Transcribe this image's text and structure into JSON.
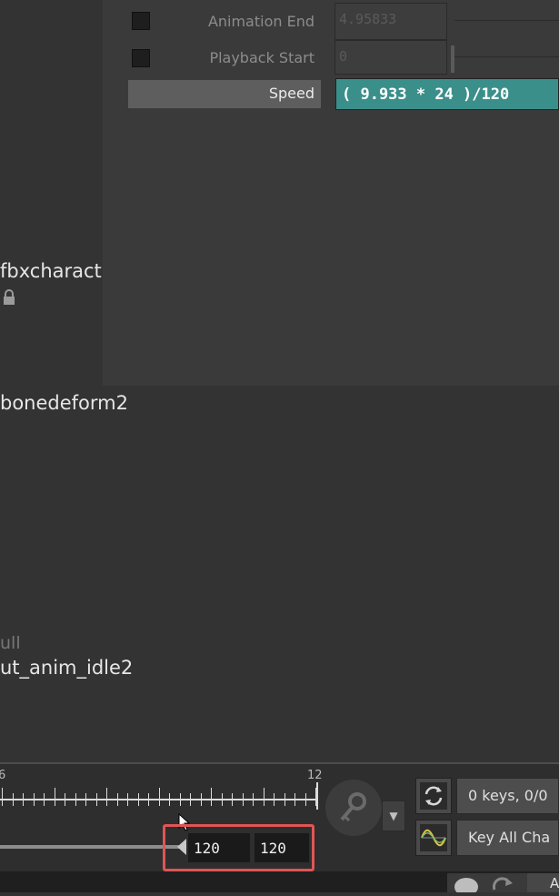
{
  "parameters": {
    "animation_end": {
      "label": "Animation End",
      "value": "4.95833"
    },
    "playback_start": {
      "label": "Playback Start",
      "value": "0"
    },
    "speed": {
      "label": "Speed",
      "expression": "( 9.933 * 24 )/120"
    }
  },
  "nodes": [
    {
      "label": "fbxcharact"
    },
    {
      "label": "bonedeform2"
    },
    {
      "label": "ull"
    },
    {
      "label": "ut_anim_idle2"
    }
  ],
  "timeline": {
    "ruler_left_label": "6",
    "ruler_right_label": "12",
    "range_start": "120",
    "range_end": "120"
  },
  "keys_panel": {
    "keys_button": "0 keys, 0/0",
    "key_all_button": "Key All Cha",
    "bottom_button": "A"
  },
  "icons": [
    "lock-icon",
    "key-icon",
    "dropdown-arrow-icon",
    "sync-icon",
    "curve-icon",
    "brain-icon",
    "redo-icon"
  ],
  "colors": {
    "speed_field": "#3b8f8a",
    "highlight": "#e05555"
  }
}
